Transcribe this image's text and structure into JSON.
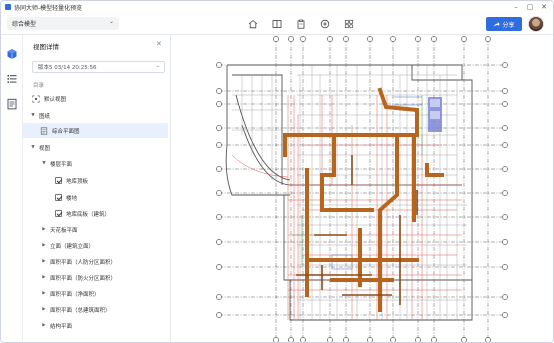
{
  "window": {
    "title": "协同大师-模型轻量化预览",
    "controls": [
      "minimize",
      "maximize",
      "close"
    ]
  },
  "toolbar": {
    "model_select": "综合模型",
    "tools": [
      "home-icon",
      "split-view-icon",
      "clipboard-icon",
      "add-circle-icon",
      "component-icon"
    ],
    "share_label": "分享"
  },
  "rail": {
    "icons": [
      "cube-icon",
      "list-icon",
      "document-icon"
    ]
  },
  "panel": {
    "title": "视图详情",
    "version": "版本5 03/14 20:25:56",
    "section_label": "目录",
    "tree": [
      {
        "label": "默认视图",
        "icon": "view-icon",
        "level": 0
      },
      {
        "label": "图纸",
        "expanded": true,
        "level": 0
      },
      {
        "label": "综合平面图",
        "icon": "drawing-icon",
        "level": 1,
        "selected": true
      },
      {
        "label": "视图",
        "expanded": true,
        "level": 0
      },
      {
        "label": "楼层平面",
        "expanded": true,
        "level": 1
      },
      {
        "label": "地库顶板",
        "checked": true,
        "level": 2
      },
      {
        "label": "楼地",
        "checked": true,
        "level": 2
      },
      {
        "label": "地库底板（建筑）",
        "checked": true,
        "level": 2
      },
      {
        "label": "天花板平面",
        "expanded": false,
        "level": 1
      },
      {
        "label": "立面（建筑立面）",
        "expanded": false,
        "level": 1
      },
      {
        "label": "面积平面（人防分区面积）",
        "expanded": false,
        "level": 1
      },
      {
        "label": "面积平面（防火分区面积）",
        "expanded": false,
        "level": 1
      },
      {
        "label": "面积平面（净面积）",
        "expanded": false,
        "level": 1
      },
      {
        "label": "面积平面（总建筑面积）",
        "expanded": false,
        "level": 1
      },
      {
        "label": "结构平面",
        "expanded": false,
        "level": 1
      }
    ]
  },
  "colors": {
    "accent": "#2f6ddf",
    "selected_bg": "#e8f0fd",
    "pipe": "#b5651d",
    "red_lines": "#e05a5a",
    "wall": "#555555"
  }
}
